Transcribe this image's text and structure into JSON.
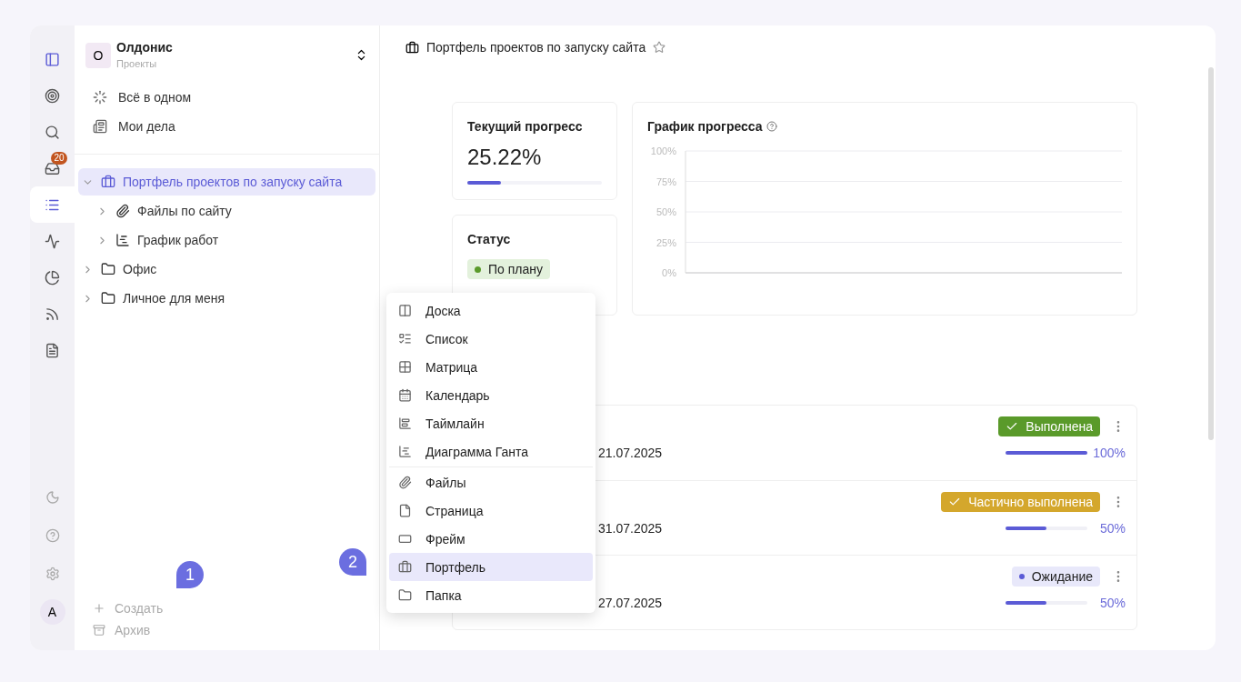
{
  "workspace": {
    "avatar": "О",
    "name": "Олдонис",
    "subtitle": "Проекты"
  },
  "rail": {
    "inbox_badge": "20",
    "user_avatar": "А",
    "items": [
      {
        "selected": false
      },
      {
        "selected": false
      },
      {
        "selected": false
      },
      {
        "selected": false
      },
      {
        "selected": true
      },
      {
        "selected": false
      },
      {
        "selected": false
      },
      {
        "selected": false
      },
      {
        "selected": false
      }
    ]
  },
  "quick_links": [
    {
      "kind": "all",
      "label": "Всё в одном"
    },
    {
      "kind": "mine",
      "label": "Мои дела"
    }
  ],
  "tree": [
    {
      "kind": "portfolio",
      "label": "Портфель проектов по запуску сайта",
      "selected": true,
      "expanded": true,
      "children": [
        {
          "kind": "files",
          "label": "Файлы по сайту",
          "selected": false,
          "expanded": false
        },
        {
          "kind": "gantt",
          "label": "График работ",
          "selected": false,
          "expanded": false
        }
      ]
    },
    {
      "kind": "folder",
      "label": "Офис",
      "selected": false,
      "expanded": false
    },
    {
      "kind": "folder",
      "label": "Личное для меня",
      "selected": false,
      "expanded": false
    }
  ],
  "sidebar_footer": [
    {
      "kind": "create",
      "label": "Создать"
    },
    {
      "kind": "archive",
      "label": "Архив"
    }
  ],
  "header": {
    "title": "Портфель проектов по запуску сайта",
    "starred": false
  },
  "progress_card": {
    "title": "Текущий прогресс",
    "value": "25.22%",
    "level": 0.2522
  },
  "status_card": {
    "title": "Статус",
    "status": "По плану",
    "color": "#5a9a2a"
  },
  "chart_card": {
    "title": "График прогресса",
    "axis_labels": [
      "100%",
      "75%",
      "50%",
      "25%",
      "0%"
    ]
  },
  "tasks": [
    {
      "date": "21.07.2025",
      "status": "Выполнена",
      "kind": "done",
      "level": 1,
      "reading": "100%"
    },
    {
      "date": "31.07.2025",
      "status": "Частично выполнена",
      "kind": "partial",
      "level": 0.5,
      "reading": "50%"
    },
    {
      "date": "27.07.2025",
      "status": "Ожидание",
      "kind": "waiting",
      "level": 0.5,
      "reading": "50%"
    }
  ],
  "create_menu": [
    {
      "kind": "board",
      "label": "Доска",
      "selected": false
    },
    {
      "kind": "list",
      "label": "Список",
      "selected": false
    },
    {
      "kind": "matrix",
      "label": "Матрица",
      "selected": false
    },
    {
      "kind": "calendar",
      "label": "Календарь",
      "selected": false
    },
    {
      "kind": "timeline",
      "label": "Таймлайн",
      "selected": false
    },
    {
      "kind": "gantt",
      "label": "Диаграмма Ганта",
      "selected": false
    },
    {
      "kind": "files",
      "label": "Файлы",
      "selected": false
    },
    {
      "kind": "page",
      "label": "Страница",
      "selected": false
    },
    {
      "kind": "frame",
      "label": "Фрейм",
      "selected": false
    },
    {
      "kind": "portfolio",
      "label": "Портфель",
      "selected": true
    },
    {
      "kind": "folder",
      "label": "Папка",
      "selected": false
    }
  ],
  "callouts": [
    {
      "kind": "create",
      "label": "1"
    },
    {
      "kind": "menu",
      "label": "2"
    }
  ]
}
